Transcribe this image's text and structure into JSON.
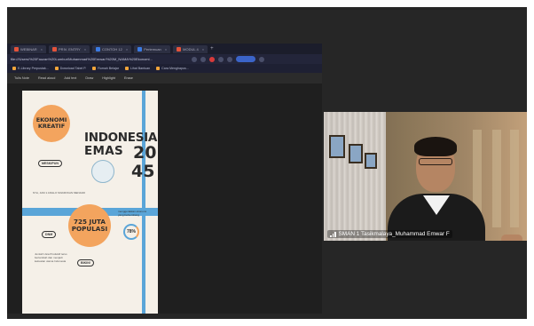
{
  "browser": {
    "tabs": [
      {
        "label": "WEBINAR",
        "color": "#e3533b"
      },
      {
        "label": "PRIV. ENTRY",
        "color": "#e3533b"
      },
      {
        "label": "CONTOH 12",
        "color": "#3b7be3"
      },
      {
        "label": "Pertemuan",
        "color": "#3b7be3"
      },
      {
        "label": "MODUL 4",
        "color": "#e3533b"
      }
    ],
    "new_tab": "+",
    "url": "file:///Users/%20Fauzan%20Lumbur/Muhammad%20Emwar/%20M_NAMA%20Ekonomi...",
    "bookmarks": [
      "E-Library Perpustak...",
      "Download Tabel P.",
      "Rumah Belajar",
      "Lihat Bantuan",
      "Cara Menghapus..."
    ],
    "pdf_toolbar": [
      "Tulis Note",
      "Read aloud",
      "Add text",
      "Draw",
      "Highlight",
      "Erase"
    ]
  },
  "poster": {
    "circle_top": [
      "EKONOMI",
      "KREATIF"
    ],
    "pill_top": "MESKIPUN",
    "headline_line1": "INDONESIA",
    "headline_line2": "EMAS",
    "headline_year_top": "20",
    "headline_year_bottom": "45",
    "subtitle": "NYA, JAM 1 ANGLO SIGNIFIKAN MENJADI",
    "circle_mid": [
      "725 JUTA",
      "POPULASI"
    ],
    "pill_mid": "DNM",
    "pill_bottom": "BIKIN!",
    "side_note": "menggerakkan ekonomi yang berkembang",
    "ring_value": "78%",
    "bottom_note": "Jumlah Usia Produktif terus bertambah dan menjadi kekuatan utama Indonesia"
  },
  "participant": {
    "name": "SMAN 1 Tasikmalaya_Muhammad Emwar F",
    "signal_icon": "signal-bars-icon"
  }
}
